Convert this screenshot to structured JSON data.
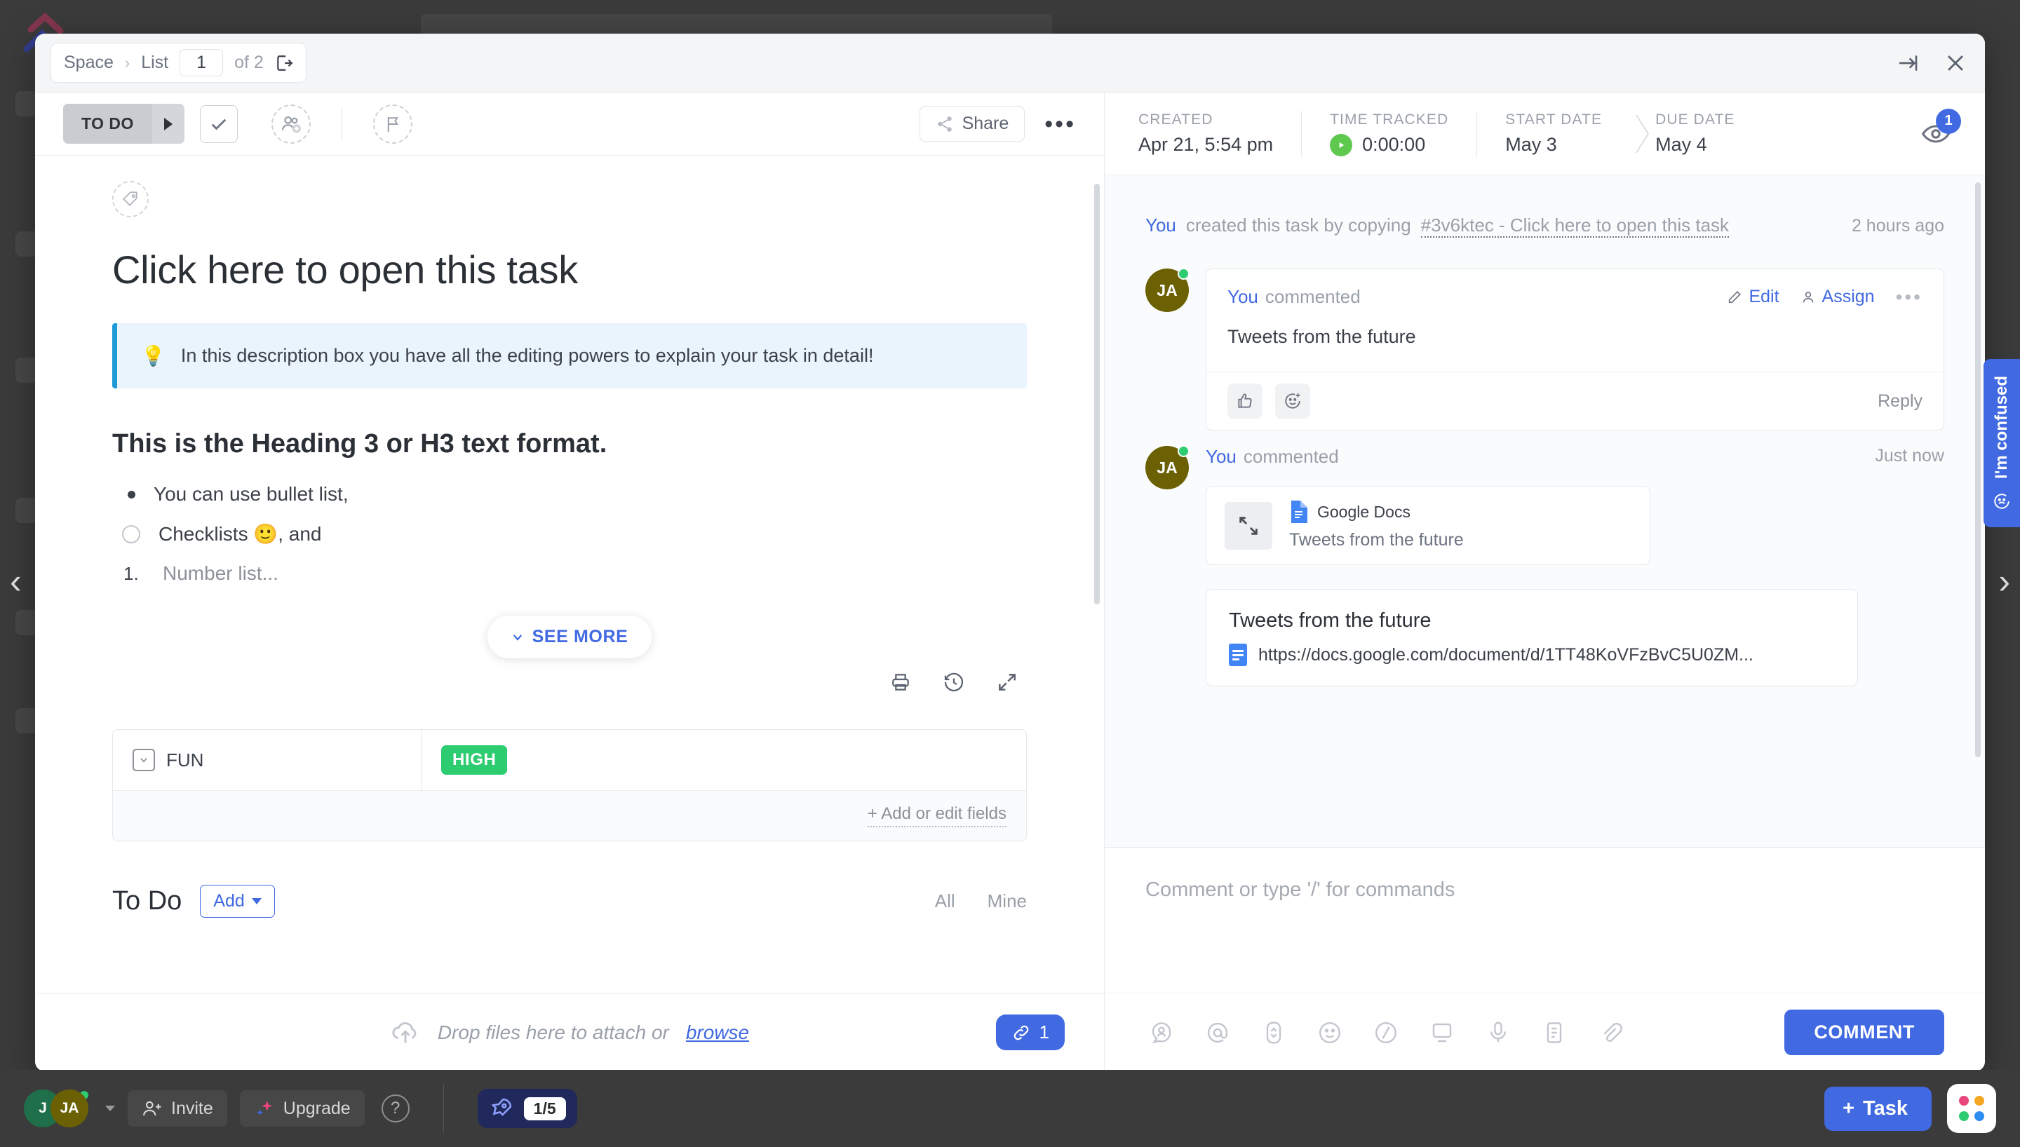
{
  "window": {
    "breadcrumb": {
      "space": "Space",
      "separator": "›",
      "list": "List"
    },
    "pagination": {
      "current": "1",
      "of_label": "of 2"
    },
    "icons": {
      "open_in_new": "open-in-new-icon",
      "expand": "expand-icon",
      "close": "close-icon"
    }
  },
  "task": {
    "status": "TO DO",
    "toolbar": {
      "share_label": "Share",
      "more_label": "•••"
    },
    "title": "Click here to open this task",
    "callout": {
      "emoji": "💡",
      "text": "In this description box you have all the editing powers to explain your task in detail!"
    },
    "heading3": "This is the Heading 3 or H3 text format.",
    "description_items": [
      {
        "type": "bullet",
        "text": "You can use bullet list,"
      },
      {
        "type": "checklist",
        "text": "Checklists 🙂, and"
      },
      {
        "type": "number",
        "marker": "1.",
        "text": "Number list..."
      }
    ],
    "see_more_label": "SEE MORE",
    "fields": {
      "rows": [
        {
          "name": "FUN",
          "value": "HIGH",
          "value_color": "#2ecc71"
        }
      ],
      "add_label": "+ Add or edit fields"
    },
    "todo": {
      "label": "To Do",
      "add_label": "Add",
      "filters": [
        "All",
        "Mine"
      ]
    },
    "attach": {
      "prefix": "Drop files here to attach or",
      "link": "browse",
      "count": "1"
    }
  },
  "meta": {
    "created": {
      "label": "CREATED",
      "value": "Apr 21, 5:54 pm"
    },
    "time_tracked": {
      "label": "TIME TRACKED",
      "value": "0:00:00"
    },
    "start_date": {
      "label": "START DATE",
      "value": "May 3"
    },
    "due_date": {
      "label": "DUE DATE",
      "value": "May 4"
    },
    "watchers_count": "1"
  },
  "activity": {
    "created_event": {
      "actor": "You",
      "text": "created this task by copying",
      "link": "#3v6ktec - Click here to open this task",
      "time": "2 hours ago"
    },
    "comments": [
      {
        "avatar": "JA",
        "actor": "You",
        "action": "commented",
        "body": "Tweets from the future",
        "edit_label": "Edit",
        "assign_label": "Assign",
        "reply_label": "Reply"
      },
      {
        "avatar": "JA",
        "actor": "You",
        "action": "commented",
        "time": "Just now",
        "attachment": {
          "source": "Google Docs",
          "title": "Tweets from the future"
        },
        "link_preview": {
          "title": "Tweets from the future",
          "url": "https://docs.google.com/document/d/1TT48KoVFzBvC5U0ZM..."
        }
      }
    ]
  },
  "composer": {
    "placeholder": "Comment or type '/' for commands",
    "submit_label": "COMMENT",
    "tools": [
      "assignee-icon",
      "mention-icon",
      "priority-icon",
      "emoji-icon",
      "slash-command-icon",
      "screen-record-icon",
      "audio-icon",
      "doc-icon",
      "attach-icon"
    ]
  },
  "confused_tab": {
    "text": "I'm confused"
  },
  "statusbar": {
    "avatars": [
      "J",
      "JA"
    ],
    "invite_label": "Invite",
    "upgrade_label": "Upgrade",
    "help_label": "?",
    "rocket_progress": "1/5",
    "task_label": "Task",
    "apps_colors": [
      "#e8467c",
      "#f5a623",
      "#2ecc71",
      "#2d8cf0"
    ]
  },
  "carousel": {
    "prev": "‹",
    "next": "›"
  }
}
